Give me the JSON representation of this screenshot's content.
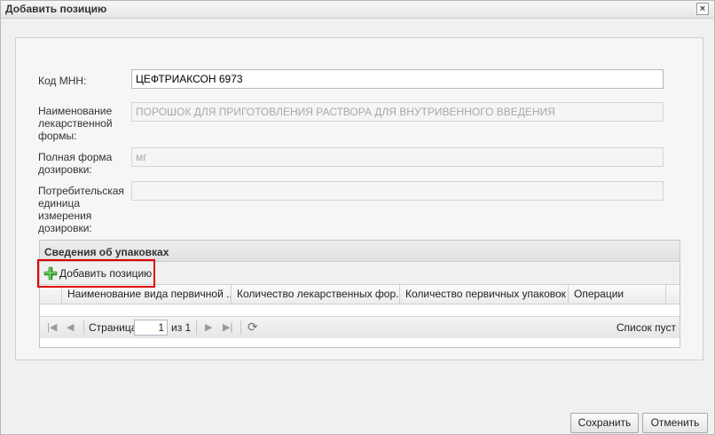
{
  "window": {
    "title": "Добавить позицию"
  },
  "form": {
    "mnn_code": {
      "label": "Код МНН:",
      "value": "ЦЕФТРИАКСОН 6973"
    },
    "dosage_form_name": {
      "label": [
        "Наименование",
        "лекарственной",
        "формы:"
      ],
      "value": "ПОРОШОК ДЛЯ ПРИГОТОВЛЕНИЯ РАСТВОРА ДЛЯ ВНУТРИВЕННОГО ВВЕДЕНИЯ"
    },
    "full_dosage_form": {
      "label": [
        "Полная форма",
        "дозировки:"
      ],
      "value": "мг"
    },
    "consumer_unit": {
      "label": [
        "Потребительская",
        "единица",
        "измерения",
        "дозировки:"
      ],
      "value": ""
    }
  },
  "packaging": {
    "title": "Сведения об упаковках",
    "add_button_label": "Добавить позицию",
    "columns": [
      "Наименование вида первичной ...",
      "Количество лекарственных фор...",
      "Количество первичных упаковок ...",
      "Операции"
    ],
    "rows": [],
    "pager": {
      "page_label": "Страница",
      "page_value": "1",
      "of_label": "из 1",
      "empty_text": "Список пуст"
    }
  },
  "footer": {
    "save_label": "Сохранить",
    "cancel_label": "Отменить"
  },
  "colors": {
    "highlight": "#e00000",
    "add_icon": "#3aa335"
  }
}
